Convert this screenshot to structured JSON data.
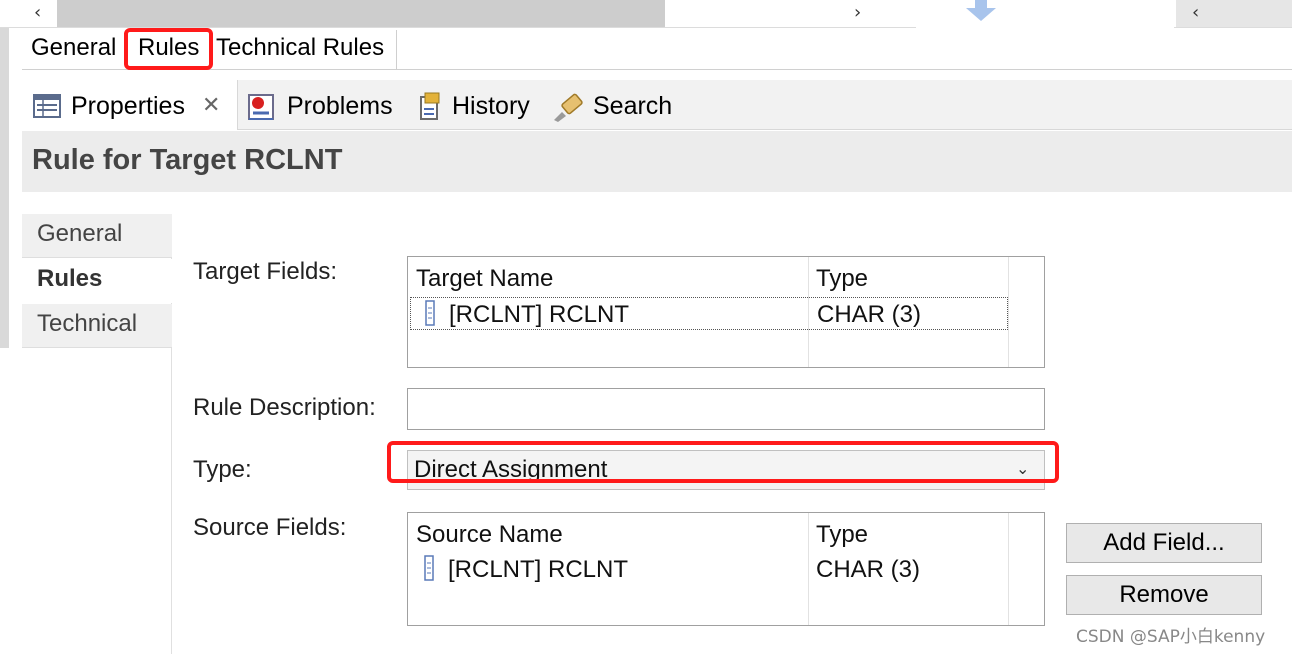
{
  "top_tabs": [
    "General",
    "Rules",
    "Technical Rules"
  ],
  "view_tabs": {
    "properties": "Properties",
    "problems": "Problems",
    "history": "History",
    "search": "Search"
  },
  "header_title": "Rule for Target RCLNT",
  "sections": [
    "General",
    "Rules",
    "Technical"
  ],
  "target_fields": {
    "label": "Target Fields:",
    "columns": [
      "Target Name",
      "Type"
    ],
    "rows": [
      {
        "name": "[RCLNT] RCLNT",
        "type": "CHAR (3)"
      }
    ]
  },
  "rule_description": {
    "label": "Rule Description:",
    "value": ""
  },
  "type_field": {
    "label": "Type:",
    "value": "Direct Assignment"
  },
  "source_fields": {
    "label": "Source Fields:",
    "columns": [
      "Source Name",
      "Type"
    ],
    "rows": [
      {
        "name": "[RCLNT] RCLNT",
        "type": "CHAR (3)"
      }
    ]
  },
  "buttons": {
    "add_field": "Add Field...",
    "remove": "Remove"
  },
  "watermark": "CSDN @SAP小白kenny",
  "colors": {
    "highlight": "#ff1a1a",
    "header_bg": "#ececec"
  }
}
